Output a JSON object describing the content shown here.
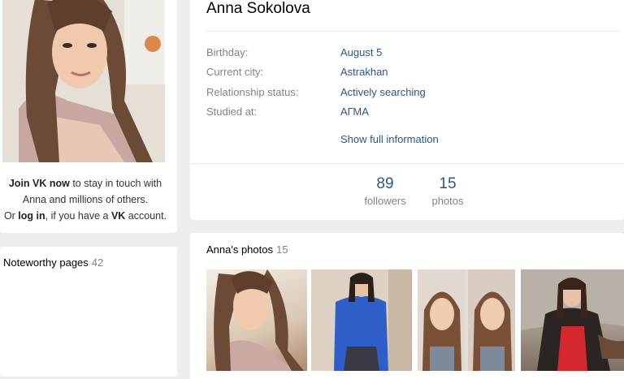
{
  "profile": {
    "name": "Anna Sokolova",
    "info": [
      {
        "label": "Birthday:",
        "value": "August 5"
      },
      {
        "label": "Current city:",
        "value": "Astrakhan"
      },
      {
        "label": "Relationship status:",
        "value": "Actively searching"
      },
      {
        "label": "Studied at:",
        "value": "АГМА"
      }
    ],
    "show_full": "Show full information",
    "stats": [
      {
        "value": "89",
        "label": "followers"
      },
      {
        "value": "15",
        "label": "photos"
      }
    ]
  },
  "join": {
    "link_join": "Join VK now",
    "text1": " to stay in touch with",
    "text2": "Anna and millions of others.",
    "text3": "Or ",
    "link_login": "log in",
    "text4": ", if you have a ",
    "brand": "VK",
    "text5": " account."
  },
  "noteworthy": {
    "title": "Noteworthy pages",
    "count": "42"
  },
  "photos": {
    "title": "Anna's photos",
    "count": "15"
  },
  "colors": {
    "link": "#2a5885",
    "muted": "#828282",
    "background": "#edeef0"
  }
}
